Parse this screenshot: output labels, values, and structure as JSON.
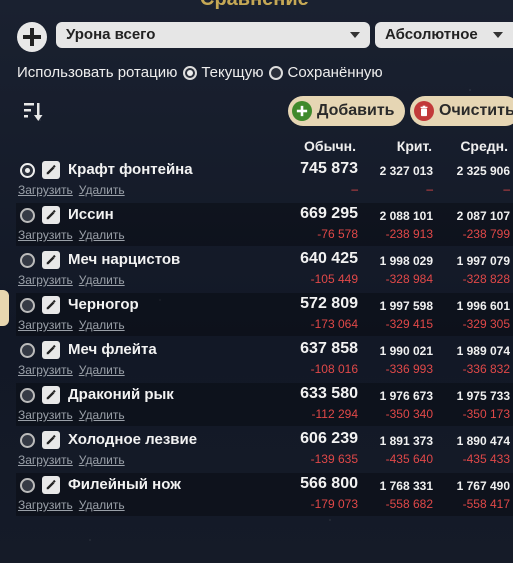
{
  "title": "Сравнение",
  "controls": {
    "metric_select": "Урона всего",
    "mode_select": "Абсолютное",
    "rotation_label": "Использовать ротацию",
    "rotation_options": [
      "Текущую",
      "Сохранённую"
    ],
    "rotation_selected": "Текущую",
    "add_label": "Добавить",
    "clear_label": "Очистить"
  },
  "columns": [
    "Обычн.",
    "Крит.",
    "Средн."
  ],
  "rows": [
    {
      "name": "Крафт фонтейна",
      "selected": true,
      "normal": "745 873",
      "crit": "2 327 013",
      "avg": "2 325 906",
      "d_normal": "–",
      "d_crit": "–",
      "d_avg": "–",
      "load": "Загрузить",
      "del": "Удалить"
    },
    {
      "name": "Иссин",
      "selected": false,
      "normal": "669 295",
      "crit": "2 088 101",
      "avg": "2 087 107",
      "d_normal": "-76 578",
      "d_crit": "-238 913",
      "d_avg": "-238 799",
      "load": "Загрузить",
      "del": "Удалить"
    },
    {
      "name": "Меч нарцистов",
      "selected": false,
      "normal": "640 425",
      "crit": "1 998 029",
      "avg": "1 997 079",
      "d_normal": "-105 449",
      "d_crit": "-328 984",
      "d_avg": "-328 828",
      "load": "Загрузить",
      "del": "Удалить"
    },
    {
      "name": "Черногор",
      "selected": false,
      "normal": "572 809",
      "crit": "1 997 598",
      "avg": "1 996 601",
      "d_normal": "-173 064",
      "d_crit": "-329 415",
      "d_avg": "-329 305",
      "load": "Загрузить",
      "del": "Удалить"
    },
    {
      "name": "Меч флейта",
      "selected": false,
      "normal": "637 858",
      "crit": "1 990 021",
      "avg": "1 989 074",
      "d_normal": "-108 016",
      "d_crit": "-336 993",
      "d_avg": "-336 832",
      "load": "Загрузить",
      "del": "Удалить"
    },
    {
      "name": "Драконий рык",
      "selected": false,
      "normal": "633 580",
      "crit": "1 976 673",
      "avg": "1 975 733",
      "d_normal": "-112 294",
      "d_crit": "-350 340",
      "d_avg": "-350 173",
      "load": "Загрузить",
      "del": "Удалить"
    },
    {
      "name": "Холодное лезвие",
      "selected": false,
      "normal": "606 239",
      "crit": "1 891 373",
      "avg": "1 890 474",
      "d_normal": "-139 635",
      "d_crit": "-435 640",
      "d_avg": "-435 433",
      "load": "Загрузить",
      "del": "Удалить"
    },
    {
      "name": "Филейный нож",
      "selected": false,
      "normal": "566 800",
      "crit": "1 768 331",
      "avg": "1 767 490",
      "d_normal": "-179 073",
      "d_crit": "-558 682",
      "d_avg": "-558 417",
      "load": "Загрузить",
      "del": "Удалить"
    }
  ]
}
